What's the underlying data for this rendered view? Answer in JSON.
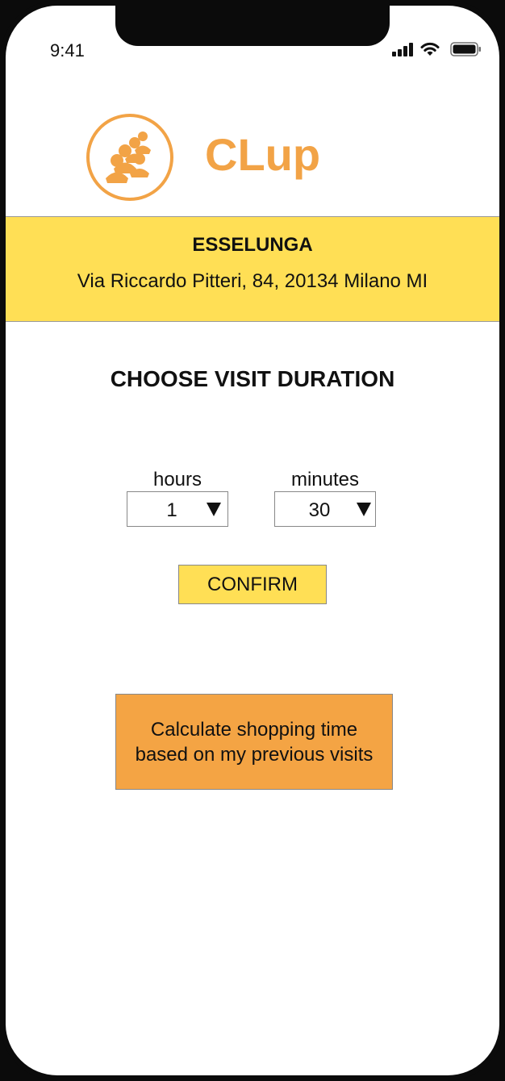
{
  "status_bar": {
    "time": "9:41"
  },
  "app": {
    "name": "CLup",
    "accent_color": "#f2a346"
  },
  "store": {
    "name": "ESSELUNGA",
    "address": "Via Riccardo Pitteri, 84, 20134 Milano MI",
    "banner_color": "#ffdf55"
  },
  "duration": {
    "title": "CHOOSE VISIT DURATION",
    "hours_label": "hours",
    "hours_value": "1",
    "minutes_label": "minutes",
    "minutes_value": "30"
  },
  "actions": {
    "confirm_label": "CONFIRM",
    "calculate_line1": "Calculate shopping time",
    "calculate_line2": "based on my previous visits",
    "calculate_color": "#f4a444"
  }
}
